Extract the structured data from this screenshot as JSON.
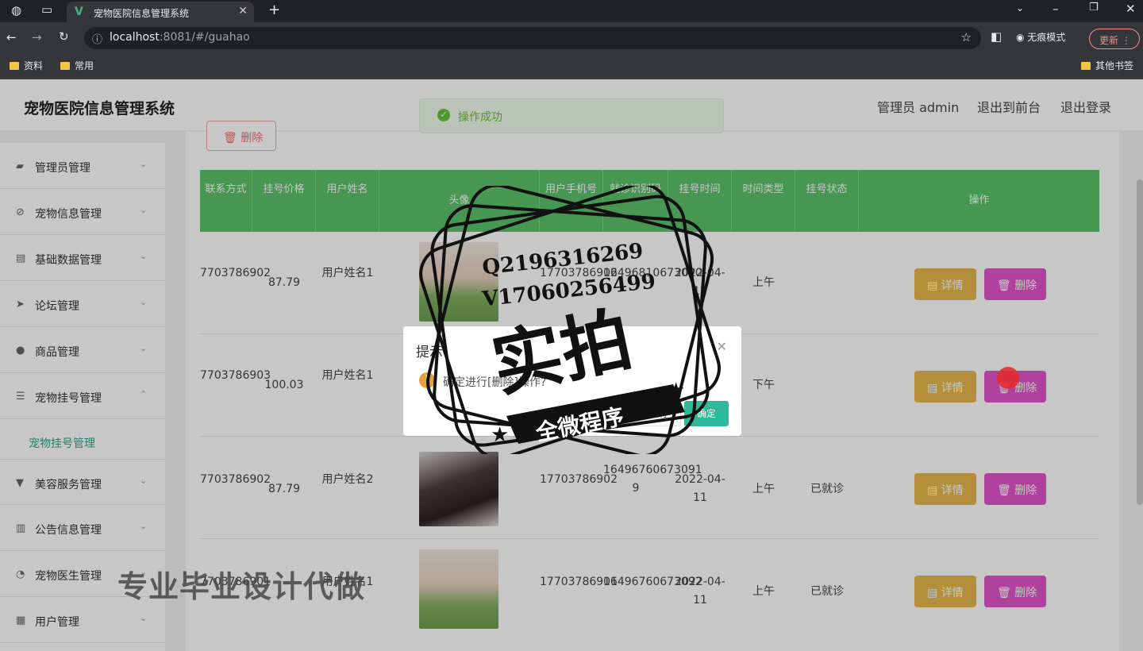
{
  "browser": {
    "tab_title": "宠物医院信息管理系统",
    "url_host": "localhost",
    "url_rest": ":8081/#/guahao",
    "incognito_label": "无痕模式",
    "update_label": "更新",
    "bookmarks": [
      "资料",
      "常用"
    ],
    "other_bookmarks": "其他书签"
  },
  "header": {
    "title": "宠物医院信息管理系统",
    "admin": "管理员 admin",
    "front": "退出到前台",
    "logout": "退出登录"
  },
  "toast": "操作成功",
  "toolbar": {
    "delete": "删除"
  },
  "sidebar": {
    "items": [
      {
        "label": "管理员管理",
        "icon": "admin-icon"
      },
      {
        "label": "宠物信息管理",
        "icon": "pet-icon"
      },
      {
        "label": "基础数据管理",
        "icon": "data-icon"
      },
      {
        "label": "论坛管理",
        "icon": "send-icon"
      },
      {
        "label": "商品管理",
        "icon": "user-icon"
      },
      {
        "label": "宠物挂号管理",
        "icon": "list-icon"
      },
      {
        "label": "美容服务管理",
        "icon": "service-icon"
      },
      {
        "label": "公告信息管理",
        "icon": "chart-icon"
      },
      {
        "label": "宠物医生管理",
        "icon": "doctor-icon"
      },
      {
        "label": "用户管理",
        "icon": "doc-icon"
      }
    ],
    "sub_active": "宠物挂号管理"
  },
  "table": {
    "headers": [
      "联系方式",
      "挂号价格",
      "用户姓名",
      "头像",
      "用户手机号",
      "就诊识别码",
      "挂号时间",
      "时间类型",
      "挂号状态",
      "操作"
    ],
    "rows": [
      {
        "phone": "7703786902",
        "price": "87.79",
        "name": "用户姓名1",
        "mobile": "17703786902",
        "code": "16496810673090",
        "date": "2022-04-12",
        "slot": "上午",
        "status": ""
      },
      {
        "phone": "7703786903",
        "price": "100.03",
        "name": "用户姓名1",
        "mobile": "",
        "code": "",
        "date": "",
        "slot": "下午",
        "status": ""
      },
      {
        "phone": "7703786902",
        "price": "87.79",
        "name": "用户姓名2",
        "mobile": "17703786902",
        "code": "16496760673091 9",
        "date": "2022-04-11",
        "slot": "上午",
        "status": "已就诊"
      },
      {
        "phone": "7703786901",
        "price": "",
        "name": "用户姓名1",
        "mobile": "17703786901",
        "code": "16496760673092",
        "date": "2022-04-11",
        "slot": "上午",
        "status": "已就诊"
      }
    ],
    "detail_label": "详情",
    "delete_label": "删除"
  },
  "dialog": {
    "title": "提示",
    "message": "确定进行[删除]操作?",
    "cancel": "取消",
    "confirm": "确定"
  },
  "stamp": {
    "line1": "Q2196316269",
    "line2": "V17060256499",
    "big": "实拍",
    "banner": "全微程序"
  },
  "watermark": "专业毕业设计代做"
}
